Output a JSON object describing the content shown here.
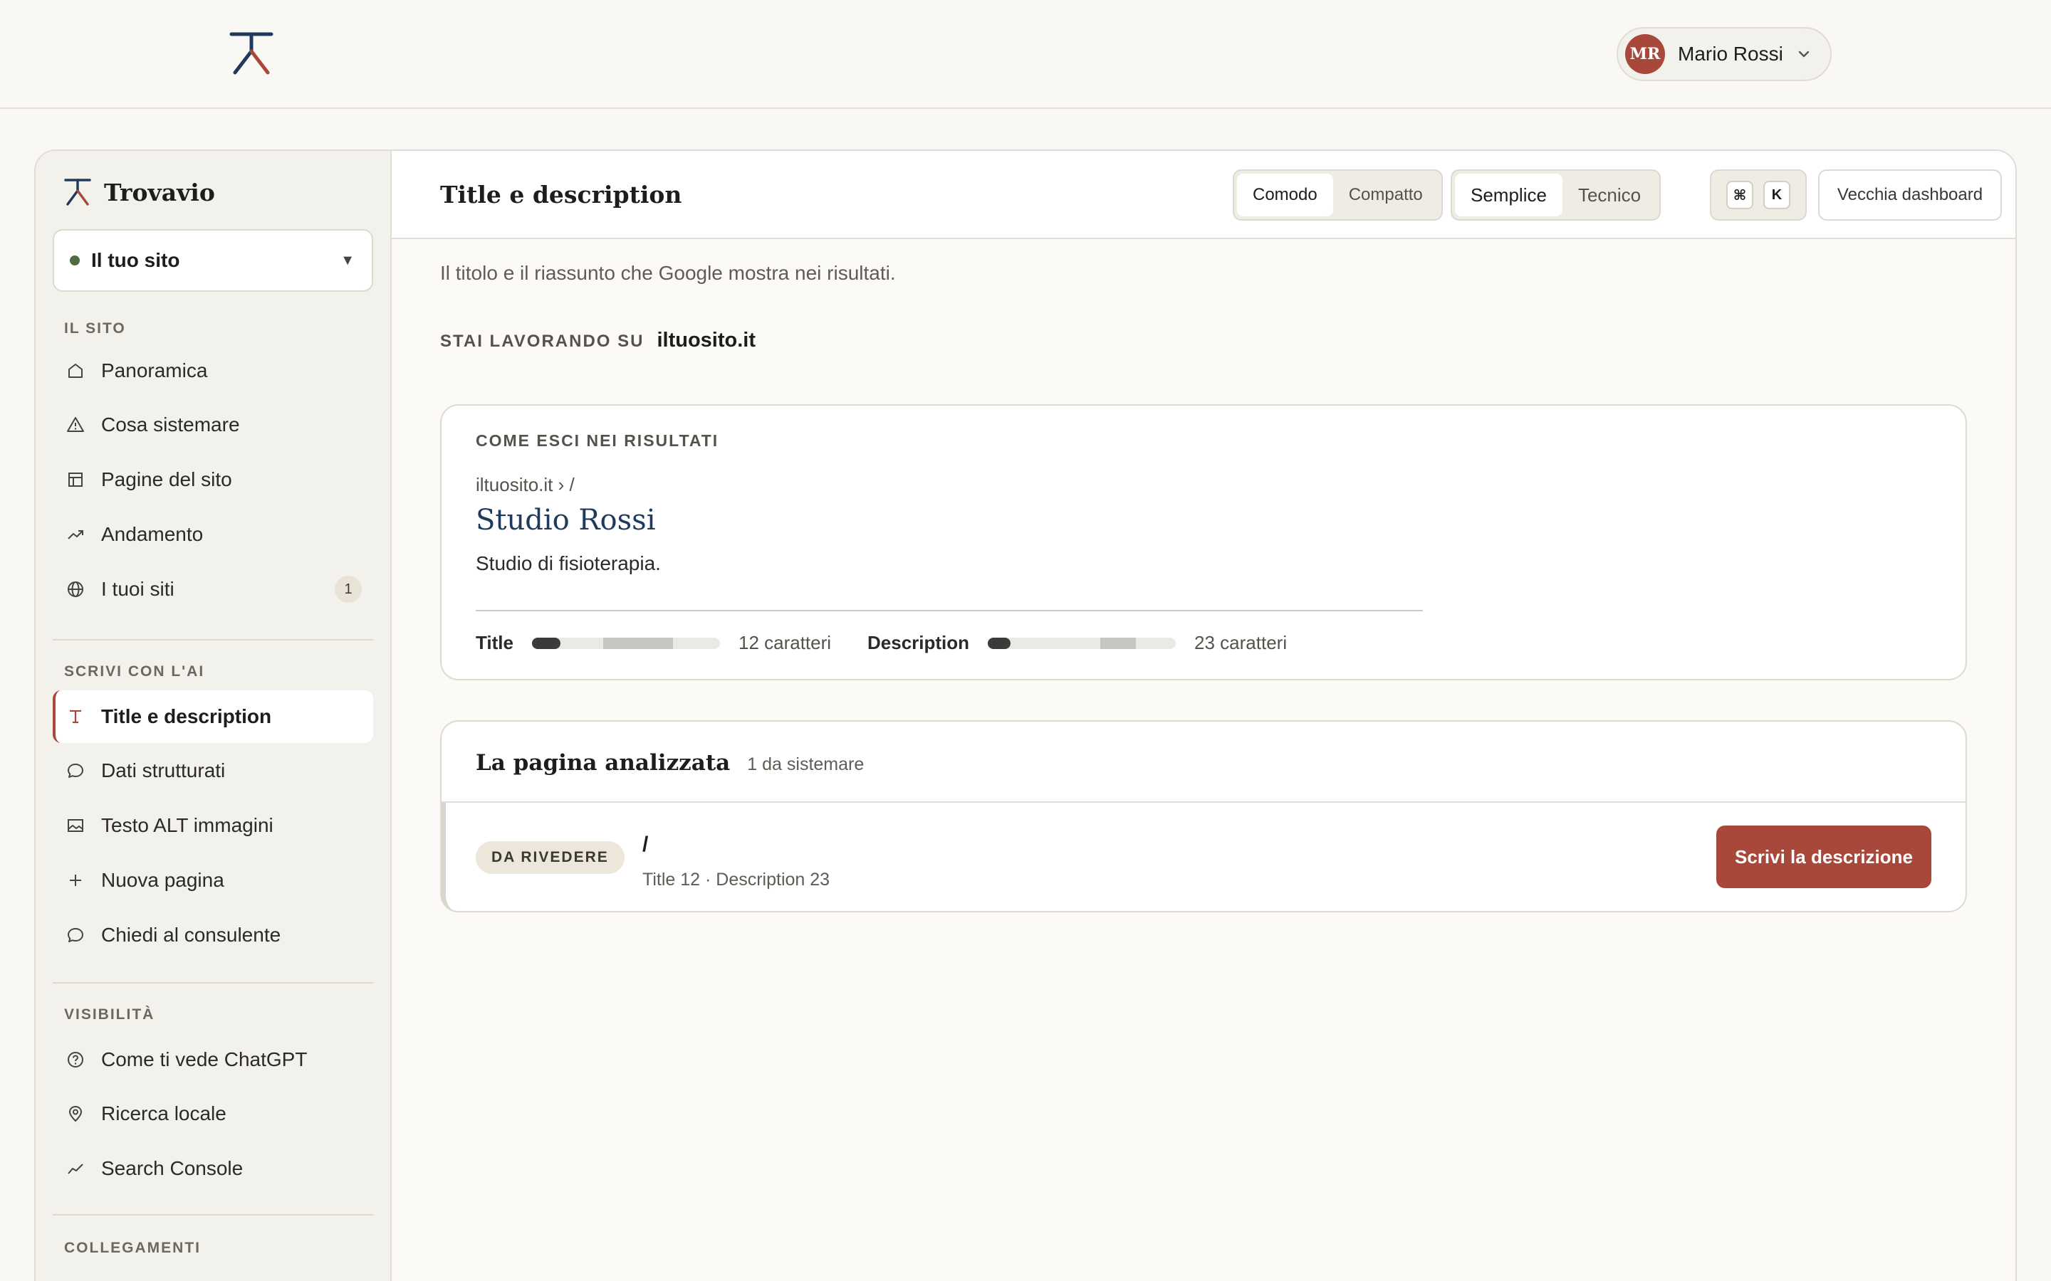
{
  "header": {
    "logo_icon": "trovavio-logo-icon",
    "user": {
      "initials": "MR",
      "name": "Mario Rossi",
      "avatar_color": "#a8483a"
    }
  },
  "sidebar": {
    "brand": "Trovavio",
    "site_selector": {
      "label": "Il tuo sito",
      "status_color": "#4f6b44"
    },
    "sections": [
      {
        "title": "IL SITO",
        "items": [
          {
            "label": "Panoramica",
            "icon": "home-icon"
          },
          {
            "label": "Cosa sistemare",
            "icon": "warning-icon"
          },
          {
            "label": "Pagine del sito",
            "icon": "layout-icon"
          },
          {
            "label": "Andamento",
            "icon": "trend-icon"
          },
          {
            "label": "I tuoi siti",
            "icon": "globe-icon",
            "badge": "1"
          }
        ]
      },
      {
        "title": "SCRIVI CON L'AI",
        "items": [
          {
            "label": "Title e description",
            "icon": "type-icon",
            "active": true
          },
          {
            "label": "Dati strutturati",
            "icon": "chat-icon"
          },
          {
            "label": "Testo ALT immagini",
            "icon": "image-icon"
          },
          {
            "label": "Nuova pagina",
            "icon": "plus-icon"
          },
          {
            "label": "Chiedi al consulente",
            "icon": "chat-icon"
          }
        ]
      },
      {
        "title": "VISIBILITÀ",
        "items": [
          {
            "label": "Come ti vede ChatGPT",
            "icon": "help-circle-icon"
          },
          {
            "label": "Ricerca locale",
            "icon": "map-pin-icon"
          },
          {
            "label": "Search Console",
            "icon": "line-chart-icon"
          }
        ]
      },
      {
        "title": "COLLEGAMENTI",
        "items": []
      }
    ]
  },
  "main": {
    "title": "Title e description",
    "density_toggle": {
      "options": [
        "Comodo",
        "Compatto"
      ],
      "selected": "Comodo"
    },
    "mode_toggle": {
      "options": [
        "Semplice",
        "Tecnico"
      ],
      "selected": "Semplice"
    },
    "shortcut": [
      "⌘",
      "K"
    ],
    "old_dashboard": "Vecchia dashboard",
    "subtitle": "Il titolo e il riassunto che Google mostra nei risultati.",
    "working_on": {
      "label": "STAI LAVORANDO SU",
      "domain": "iltuosito.it"
    },
    "serp_preview": {
      "label": "COME ESCI NEI RISULTATI",
      "breadcrumb": "iltuosito.it › /",
      "title": "Studio Rossi",
      "description": "Studio di fisioterapia.",
      "title_metric": {
        "label": "Title",
        "chars_text": "12 caratteri",
        "chars": 12
      },
      "description_metric": {
        "label": "Description",
        "chars_text": "23 caratteri",
        "chars": 23
      }
    },
    "pages": {
      "title": "La pagina analizzata",
      "count_text": "1 da sistemare",
      "rows": [
        {
          "status": "DA RIVEDERE",
          "path": "/",
          "meta": "Title 12 · Description 23",
          "action": "Scrivi la descrizione"
        }
      ]
    }
  }
}
